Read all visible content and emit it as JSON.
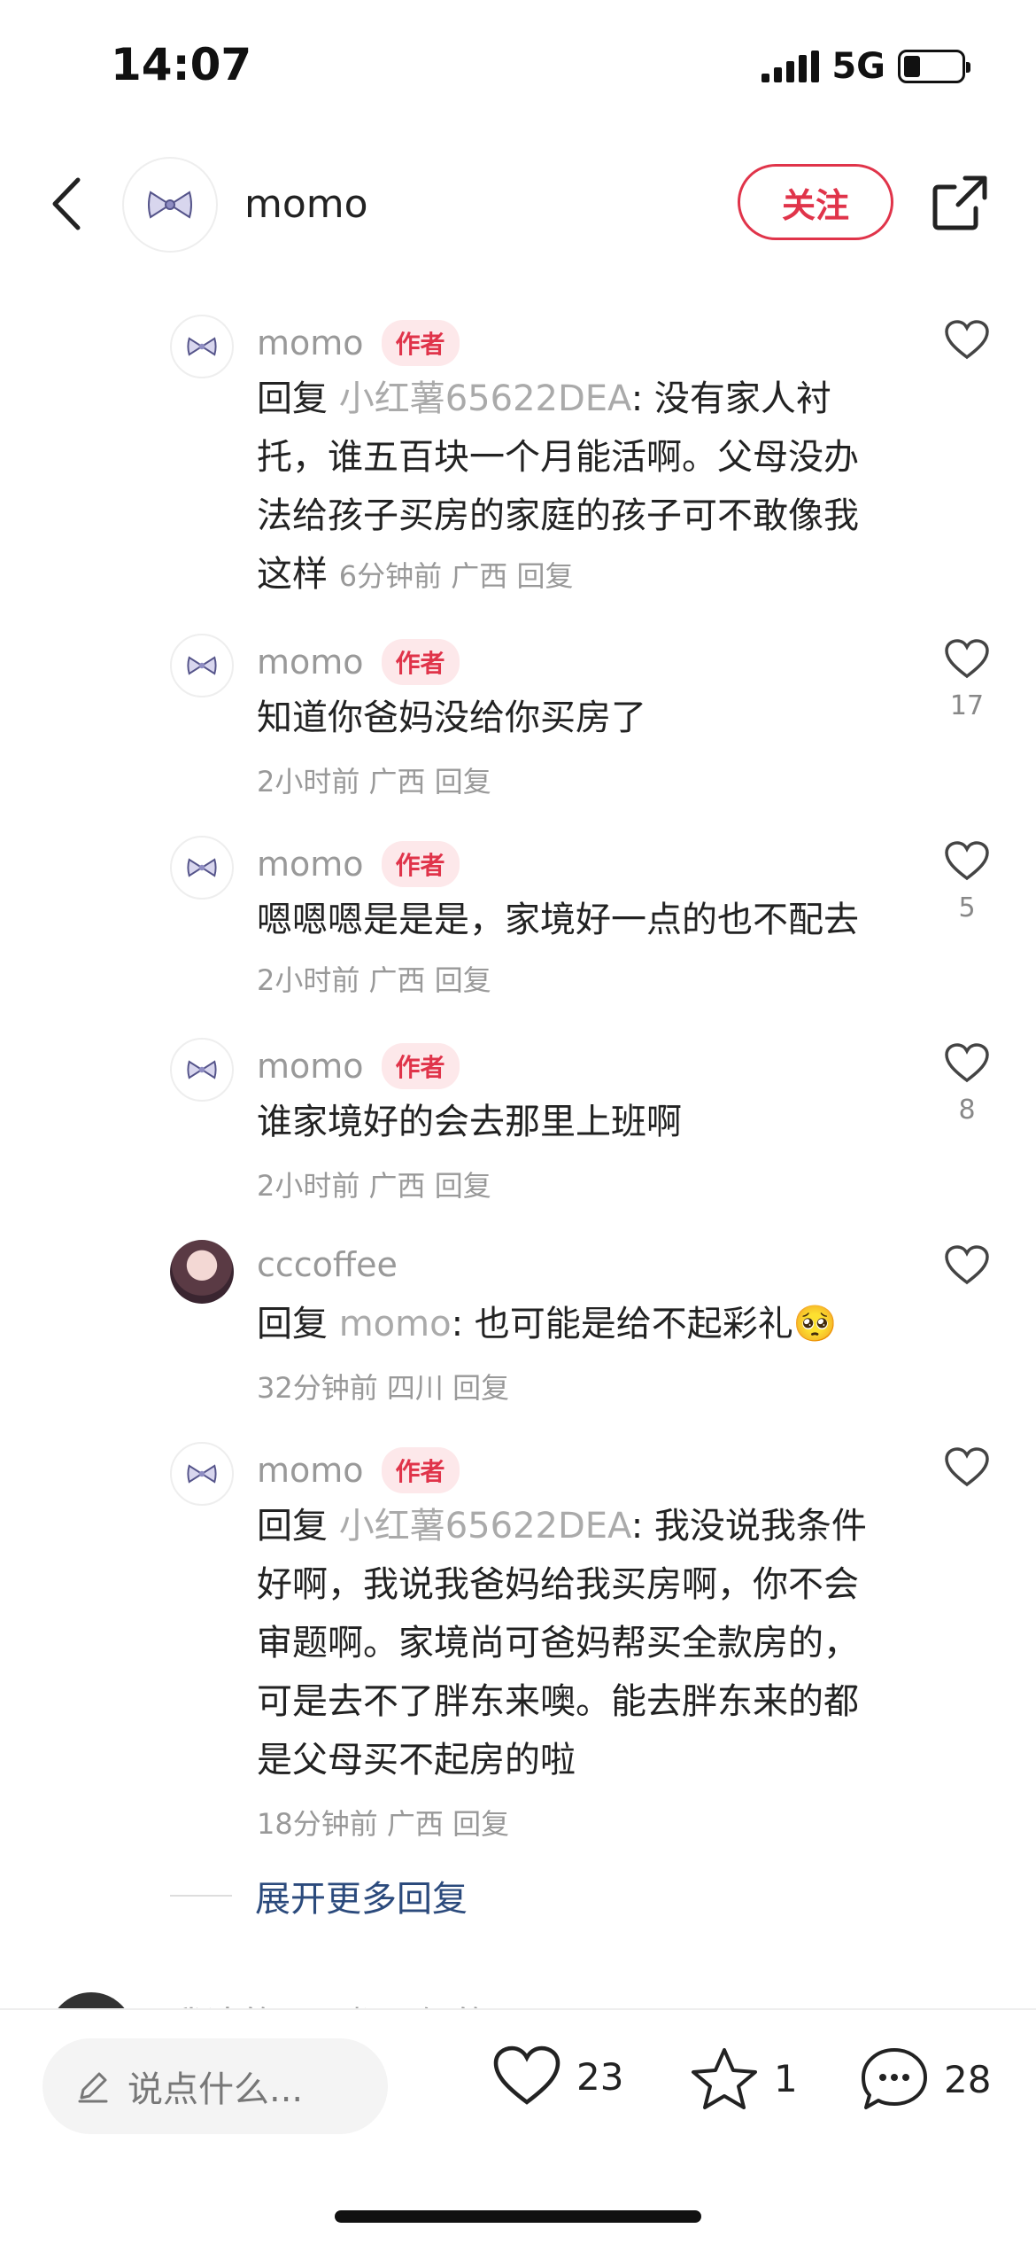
{
  "status_bar": {
    "time": "14:07",
    "network": "5G",
    "battery_percent": 25
  },
  "header": {
    "user_name": "momo",
    "follow_label": "关注"
  },
  "author_badge": "作者",
  "comments": [
    {
      "name": "momo",
      "author": true,
      "reply_prefix": "回复",
      "reply_to": "小红薯65622DEA",
      "text": ": 没有家人衬托，谁五百块一个月能活啊。父母没办法给孩子买房的家庭的孩子可不敢像我这样",
      "time": "6分钟前",
      "location": "广西",
      "reply_label": "回复",
      "likes": ""
    },
    {
      "name": "momo",
      "author": true,
      "reply_prefix": "",
      "reply_to": "",
      "text": "知道你爸妈没给你买房了",
      "time": "2小时前",
      "location": "广西",
      "reply_label": "回复",
      "likes": "17"
    },
    {
      "name": "momo",
      "author": true,
      "reply_prefix": "",
      "reply_to": "",
      "text": "嗯嗯嗯是是是，家境好一点的也不配去",
      "time": "2小时前",
      "location": "广西",
      "reply_label": "回复",
      "likes": "5"
    },
    {
      "name": "momo",
      "author": true,
      "reply_prefix": "",
      "reply_to": "",
      "text": "谁家境好的会去那里上班啊",
      "time": "2小时前",
      "location": "广西",
      "reply_label": "回复",
      "likes": "8"
    },
    {
      "name": "cccoffee",
      "author": false,
      "reply_prefix": "回复",
      "reply_to": "momo",
      "text": ": 也可能是给不起彩礼",
      "emoji": "🥺",
      "time": "32分钟前",
      "location": "四川",
      "reply_label": "回复",
      "likes": ""
    },
    {
      "name": "momo",
      "author": true,
      "reply_prefix": "回复",
      "reply_to": "小红薯65622DEA",
      "text": ": 我没说我条件好啊，我说我爸妈给我买房啊，你不会审题啊。家境尚可爸妈帮买全款房的，可是去不了胖东来噢。能去胖东来的都是父母买不起房的啦",
      "time": "18分钟前",
      "location": "广西",
      "reply_label": "回复",
      "likes": ""
    }
  ],
  "expand_label": "展开更多回复",
  "peek_text": "我追的……都是假的",
  "bottom_bar": {
    "input_placeholder": "说点什么...",
    "likes": "23",
    "stars": "1",
    "comments": "28"
  },
  "colors": {
    "accent": "#e0344a",
    "link": "#2b4a7c",
    "muted": "#999999"
  }
}
